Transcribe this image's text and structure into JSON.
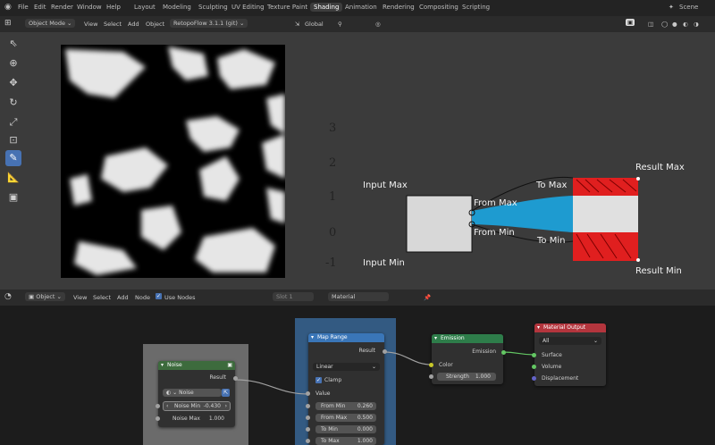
{
  "top_menu": [
    "File",
    "Edit",
    "Render",
    "Window",
    "Help"
  ],
  "workspace_tabs": [
    "Layout",
    "Modeling",
    "Sculpting",
    "UV Editing",
    "Texture Paint",
    "Shading",
    "Animation",
    "Rendering",
    "Compositing",
    "Scripting"
  ],
  "active_tab": "Shading",
  "scene_label": "Scene",
  "viewport_header": {
    "mode": "Object Mode",
    "menus": [
      "View",
      "Select",
      "Add",
      "Object"
    ],
    "addon": "RetopoFlow 3.1.1 (git)",
    "orientation": "Global"
  },
  "diagram": {
    "input_max": "Input Max",
    "input_min": "Input Min",
    "from_max": "From Max",
    "from_min": "From Min",
    "to_max": "To Max",
    "to_min": "To Min",
    "result_max": "Result Max",
    "result_min": "Result Min",
    "digits": [
      "3",
      "2",
      "1",
      "0",
      "-1"
    ]
  },
  "node_header": {
    "type": "Object",
    "menus": [
      "View",
      "Select",
      "Add",
      "Node"
    ],
    "use_nodes": "Use Nodes",
    "slot": "Slot 1",
    "material": "Material"
  },
  "nodes": {
    "noise": {
      "title": "Noise",
      "result": "Result",
      "type": "Noise",
      "noise_min": "Noise Min",
      "noise_min_value": "-0.430",
      "noise_max": "Noise Max",
      "noise_max_value": "1.000"
    },
    "map_range": {
      "title": "Map Range",
      "result": "Result",
      "interp": "Linear",
      "clamp": "Clamp",
      "value": "Value",
      "fields": [
        {
          "label": "From Min",
          "value": "0.260"
        },
        {
          "label": "From Max",
          "value": "0.500"
        },
        {
          "label": "To Min",
          "value": "0.000"
        },
        {
          "label": "To Max",
          "value": "1.000"
        }
      ]
    },
    "emission": {
      "title": "Emission",
      "output": "Emission",
      "color": "Color",
      "strength": "Strength",
      "strength_value": "1.000"
    },
    "material_output": {
      "title": "Material Output",
      "target": "All",
      "surface": "Surface",
      "volume": "Volume",
      "displacement": "Displacement"
    }
  },
  "colors": {
    "accent": "#4772b3",
    "node_input_header": "#3d6b3d",
    "node_converter_header": "#3a76b8",
    "node_shader_header": "#2e7d4a",
    "node_output_header": "#b3353d",
    "diagram_blue": "#1e9bd0",
    "diagram_red": "#e01f1f"
  },
  "tools": [
    "select-box-icon",
    "cursor-icon",
    "move-icon",
    "rotate-icon",
    "scale-icon",
    "transform-icon",
    "annotate-icon",
    "measure-icon",
    "add-cube-icon"
  ]
}
